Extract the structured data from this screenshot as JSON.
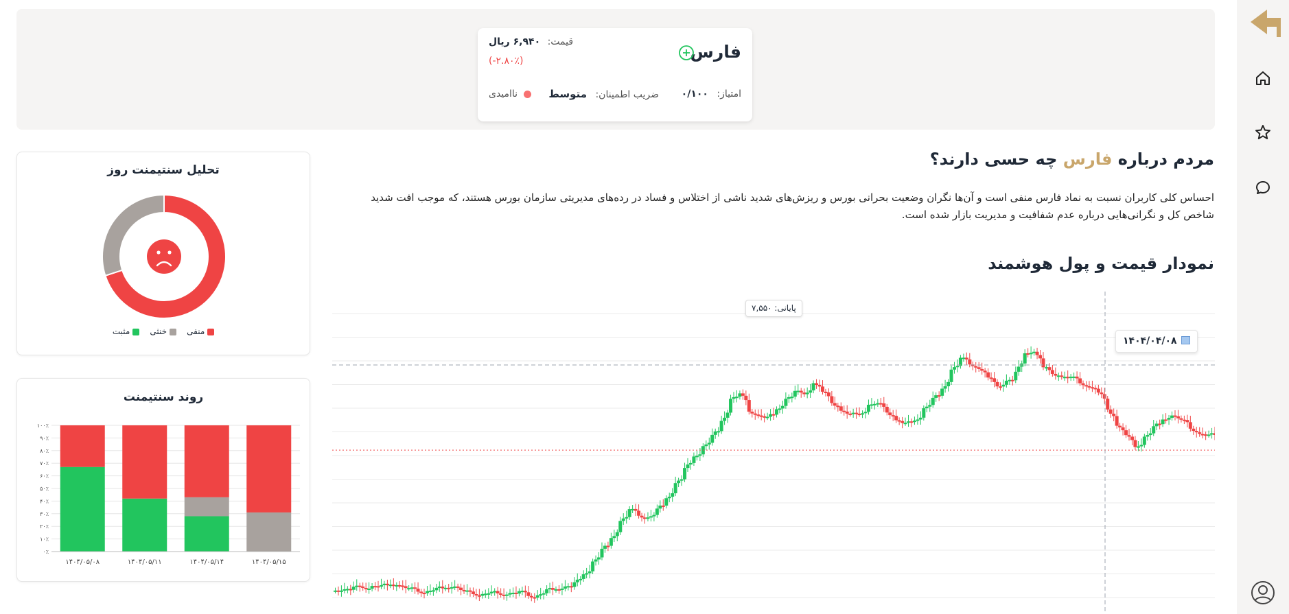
{
  "colors": {
    "accent_gold": "#c9a66b",
    "negative": "#ef4444",
    "positive": "#22c55e",
    "neutral": "#a8a29e",
    "panel_bg": "#f5f4f3",
    "text": "#1f2937"
  },
  "rail": {
    "icons": [
      "back-arrow-icon",
      "home-icon",
      "star-icon",
      "chat-icon",
      "user-icon"
    ]
  },
  "header": {
    "symbol": "فارس",
    "price_label": "قیمت:",
    "price_value": "۶,۹۴۰ ریال",
    "change": "(-۲.۸۰٪)",
    "score_label": "امتیاز:",
    "score_value": "۰/۱۰۰",
    "confidence_label": "ضریب اطمینان:",
    "confidence_value": "متوسط",
    "mood": "ناامیدی"
  },
  "sentiment_section": {
    "title_prefix": "مردم درباره",
    "title_symbol": "فارس",
    "title_suffix": "چه حسی دارند؟",
    "description": "احساس کلی کاربران نسبت به نماد فارس منفی است و آن‌ها نگران وضعیت بحرانی بورس و ریزش‌های شدید ناشی از اختلاس و فساد در رده‌های مدیریتی سازمان بورس هستند، که موجب افت شدید شاخص کل و نگرانی‌هایی درباره عدم شفافیت و مدیریت بازار شده است."
  },
  "price_section": {
    "title": "نمودار قیمت و پول هوشمند",
    "tooltip_close": "پایانی: ۷,۵۵۰",
    "crosshair_date": "۱۴۰۴/۰۴/۰۸"
  },
  "daily_sentiment": {
    "title": "تحلیل سنتیمنت روز",
    "legend": [
      "منفی",
      "خنثی",
      "مثبت"
    ]
  },
  "trend": {
    "title": "روند سنتیمنت"
  },
  "chart_data": [
    {
      "type": "pie",
      "title": "تحلیل سنتیمنت روز",
      "categories": [
        "منفی",
        "خنثی",
        "مثبت"
      ],
      "values": [
        70,
        30,
        0
      ],
      "colors": [
        "#ef4444",
        "#a8a29e",
        "#22c55e"
      ]
    },
    {
      "type": "bar",
      "stacked": true,
      "title": "روند سنتیمنت",
      "categories": [
        "۱۴۰۴/۰۵/۰۸",
        "۱۴۰۴/۰۵/۱۱",
        "۱۴۰۴/۰۵/۱۴",
        "۱۴۰۴/۰۵/۱۵"
      ],
      "series": [
        {
          "name": "مثبت",
          "values": [
            67,
            42,
            28,
            0
          ],
          "color": "#22c55e"
        },
        {
          "name": "خنثی",
          "values": [
            0,
            0,
            15,
            31
          ],
          "color": "#a8a29e"
        },
        {
          "name": "منفی",
          "values": [
            33,
            58,
            57,
            69
          ],
          "color": "#ef4444"
        }
      ],
      "ylim": [
        0,
        100
      ],
      "yticks": [
        "۰٪",
        "۱۰٪",
        "۲۰٪",
        "۳۰٪",
        "۴۰٪",
        "۵۰٪",
        "۶۰٪",
        "۷۰٪",
        "۸۰٪",
        "۹۰٪",
        "۱۰۰٪"
      ]
    },
    {
      "type": "line",
      "title": "",
      "series": [
        {
          "values": [
            5100,
            5140,
            5150,
            5180,
            5160,
            5230,
            5200,
            5120,
            5080,
            5060,
            5110,
            5150,
            5190,
            5050,
            5030,
            5000,
            5040,
            5010,
            5020,
            5060,
            4990,
            4960,
            5080,
            5120,
            5160,
            5200,
            5400,
            5650,
            5900,
            6150,
            6500,
            6800,
            6700,
            6600,
            6750,
            7000,
            7300,
            7600,
            7900,
            8100,
            8300,
            8600,
            9100,
            9300,
            8900,
            8800,
            8700,
            8900,
            9100,
            9300,
            9200,
            9500,
            9300,
            9100,
            8900,
            8800,
            8800,
            9000,
            9050,
            8900,
            8700,
            8600,
            8650,
            8900,
            9100,
            9300,
            9700,
            10000,
            9900,
            9800,
            9600,
            9400,
            9500,
            9600,
            10100,
            10200,
            9800,
            9700,
            9600,
            9600,
            9500,
            9400,
            9300,
            9000,
            8600,
            8400,
            8100,
            8300,
            8500,
            8700,
            8800,
            8700,
            8550,
            8400,
            8350,
            8400
          ]
        }
      ],
      "reference_lines": [
        9850,
        8050
      ]
    }
  ]
}
